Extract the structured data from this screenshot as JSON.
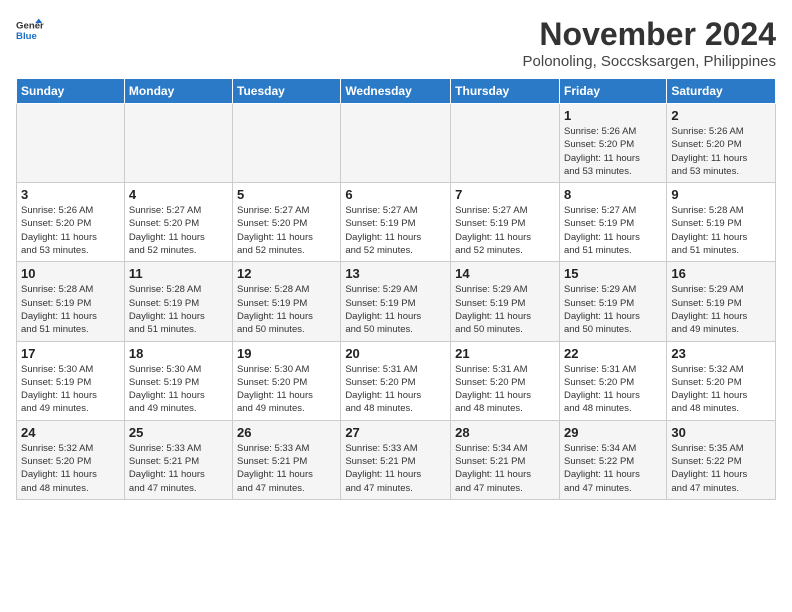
{
  "header": {
    "logo_line1": "General",
    "logo_line2": "Blue",
    "month_title": "November 2024",
    "subtitle": "Polonoling, Soccsksargen, Philippines"
  },
  "weekdays": [
    "Sunday",
    "Monday",
    "Tuesday",
    "Wednesday",
    "Thursday",
    "Friday",
    "Saturday"
  ],
  "weeks": [
    [
      {
        "day": "",
        "info": ""
      },
      {
        "day": "",
        "info": ""
      },
      {
        "day": "",
        "info": ""
      },
      {
        "day": "",
        "info": ""
      },
      {
        "day": "",
        "info": ""
      },
      {
        "day": "1",
        "info": "Sunrise: 5:26 AM\nSunset: 5:20 PM\nDaylight: 11 hours\nand 53 minutes."
      },
      {
        "day": "2",
        "info": "Sunrise: 5:26 AM\nSunset: 5:20 PM\nDaylight: 11 hours\nand 53 minutes."
      }
    ],
    [
      {
        "day": "3",
        "info": "Sunrise: 5:26 AM\nSunset: 5:20 PM\nDaylight: 11 hours\nand 53 minutes."
      },
      {
        "day": "4",
        "info": "Sunrise: 5:27 AM\nSunset: 5:20 PM\nDaylight: 11 hours\nand 52 minutes."
      },
      {
        "day": "5",
        "info": "Sunrise: 5:27 AM\nSunset: 5:20 PM\nDaylight: 11 hours\nand 52 minutes."
      },
      {
        "day": "6",
        "info": "Sunrise: 5:27 AM\nSunset: 5:19 PM\nDaylight: 11 hours\nand 52 minutes."
      },
      {
        "day": "7",
        "info": "Sunrise: 5:27 AM\nSunset: 5:19 PM\nDaylight: 11 hours\nand 52 minutes."
      },
      {
        "day": "8",
        "info": "Sunrise: 5:27 AM\nSunset: 5:19 PM\nDaylight: 11 hours\nand 51 minutes."
      },
      {
        "day": "9",
        "info": "Sunrise: 5:28 AM\nSunset: 5:19 PM\nDaylight: 11 hours\nand 51 minutes."
      }
    ],
    [
      {
        "day": "10",
        "info": "Sunrise: 5:28 AM\nSunset: 5:19 PM\nDaylight: 11 hours\nand 51 minutes."
      },
      {
        "day": "11",
        "info": "Sunrise: 5:28 AM\nSunset: 5:19 PM\nDaylight: 11 hours\nand 51 minutes."
      },
      {
        "day": "12",
        "info": "Sunrise: 5:28 AM\nSunset: 5:19 PM\nDaylight: 11 hours\nand 50 minutes."
      },
      {
        "day": "13",
        "info": "Sunrise: 5:29 AM\nSunset: 5:19 PM\nDaylight: 11 hours\nand 50 minutes."
      },
      {
        "day": "14",
        "info": "Sunrise: 5:29 AM\nSunset: 5:19 PM\nDaylight: 11 hours\nand 50 minutes."
      },
      {
        "day": "15",
        "info": "Sunrise: 5:29 AM\nSunset: 5:19 PM\nDaylight: 11 hours\nand 50 minutes."
      },
      {
        "day": "16",
        "info": "Sunrise: 5:29 AM\nSunset: 5:19 PM\nDaylight: 11 hours\nand 49 minutes."
      }
    ],
    [
      {
        "day": "17",
        "info": "Sunrise: 5:30 AM\nSunset: 5:19 PM\nDaylight: 11 hours\nand 49 minutes."
      },
      {
        "day": "18",
        "info": "Sunrise: 5:30 AM\nSunset: 5:19 PM\nDaylight: 11 hours\nand 49 minutes."
      },
      {
        "day": "19",
        "info": "Sunrise: 5:30 AM\nSunset: 5:20 PM\nDaylight: 11 hours\nand 49 minutes."
      },
      {
        "day": "20",
        "info": "Sunrise: 5:31 AM\nSunset: 5:20 PM\nDaylight: 11 hours\nand 48 minutes."
      },
      {
        "day": "21",
        "info": "Sunrise: 5:31 AM\nSunset: 5:20 PM\nDaylight: 11 hours\nand 48 minutes."
      },
      {
        "day": "22",
        "info": "Sunrise: 5:31 AM\nSunset: 5:20 PM\nDaylight: 11 hours\nand 48 minutes."
      },
      {
        "day": "23",
        "info": "Sunrise: 5:32 AM\nSunset: 5:20 PM\nDaylight: 11 hours\nand 48 minutes."
      }
    ],
    [
      {
        "day": "24",
        "info": "Sunrise: 5:32 AM\nSunset: 5:20 PM\nDaylight: 11 hours\nand 48 minutes."
      },
      {
        "day": "25",
        "info": "Sunrise: 5:33 AM\nSunset: 5:21 PM\nDaylight: 11 hours\nand 47 minutes."
      },
      {
        "day": "26",
        "info": "Sunrise: 5:33 AM\nSunset: 5:21 PM\nDaylight: 11 hours\nand 47 minutes."
      },
      {
        "day": "27",
        "info": "Sunrise: 5:33 AM\nSunset: 5:21 PM\nDaylight: 11 hours\nand 47 minutes."
      },
      {
        "day": "28",
        "info": "Sunrise: 5:34 AM\nSunset: 5:21 PM\nDaylight: 11 hours\nand 47 minutes."
      },
      {
        "day": "29",
        "info": "Sunrise: 5:34 AM\nSunset: 5:22 PM\nDaylight: 11 hours\nand 47 minutes."
      },
      {
        "day": "30",
        "info": "Sunrise: 5:35 AM\nSunset: 5:22 PM\nDaylight: 11 hours\nand 47 minutes."
      }
    ]
  ]
}
